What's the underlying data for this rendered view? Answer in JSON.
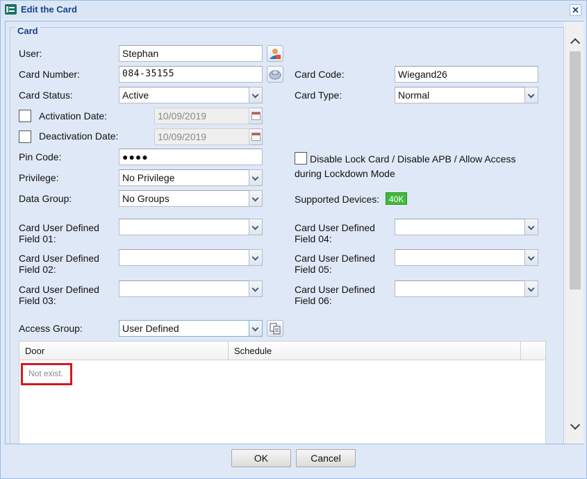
{
  "window": {
    "title": "Edit the Card",
    "close_icon": "close-icon"
  },
  "form": {
    "legend": "Card",
    "user": {
      "label": "User:",
      "value": "Stephan",
      "button_icon": "user-select-icon"
    },
    "card_number": {
      "label": "Card Number:",
      "value": "084-35155",
      "button_icon": "card-reader-icon"
    },
    "card_code": {
      "label": "Card Code:",
      "value": "Wiegand26"
    },
    "card_status": {
      "label": "Card Status:",
      "value": "Active"
    },
    "card_type": {
      "label": "Card Type:",
      "value": "Normal"
    },
    "activation_date": {
      "label": "Activation Date:",
      "value": "10/09/2019",
      "checked": false
    },
    "deactivation_date": {
      "label": "Deactivation Date:",
      "value": "10/09/2019",
      "checked": false
    },
    "pin_code": {
      "label": "Pin Code:",
      "value": "●●●●"
    },
    "disable_lock": {
      "label": "Disable Lock Card / Disable APB / Allow Access during Lockdown Mode",
      "checked": false
    },
    "privilege": {
      "label": "Privilege:",
      "value": "No Privilege"
    },
    "data_group": {
      "label": "Data Group:",
      "value": "No Groups"
    },
    "supported_devices": {
      "label": "Supported Devices:",
      "badge": "40K",
      "badge_color": "#42b93c"
    },
    "udf": {
      "f01": {
        "label": "Card User Defined Field 01:",
        "value": ""
      },
      "f02": {
        "label": "Card User Defined Field 02:",
        "value": ""
      },
      "f03": {
        "label": "Card User Defined Field 03:",
        "value": ""
      },
      "f04": {
        "label": "Card User Defined Field 04:",
        "value": ""
      },
      "f05": {
        "label": "Card User Defined Field 05:",
        "value": ""
      },
      "f06": {
        "label": "Card User Defined Field 06:",
        "value": ""
      }
    },
    "access_group": {
      "label": "Access Group:",
      "value": "User Defined",
      "button_icon": "copy-icon"
    }
  },
  "grid": {
    "columns": [
      "Door",
      "Schedule"
    ],
    "empty_text": "Not exist.",
    "highlight_color": "#d5171f"
  },
  "buttons": {
    "ok": "OK",
    "cancel": "Cancel"
  }
}
